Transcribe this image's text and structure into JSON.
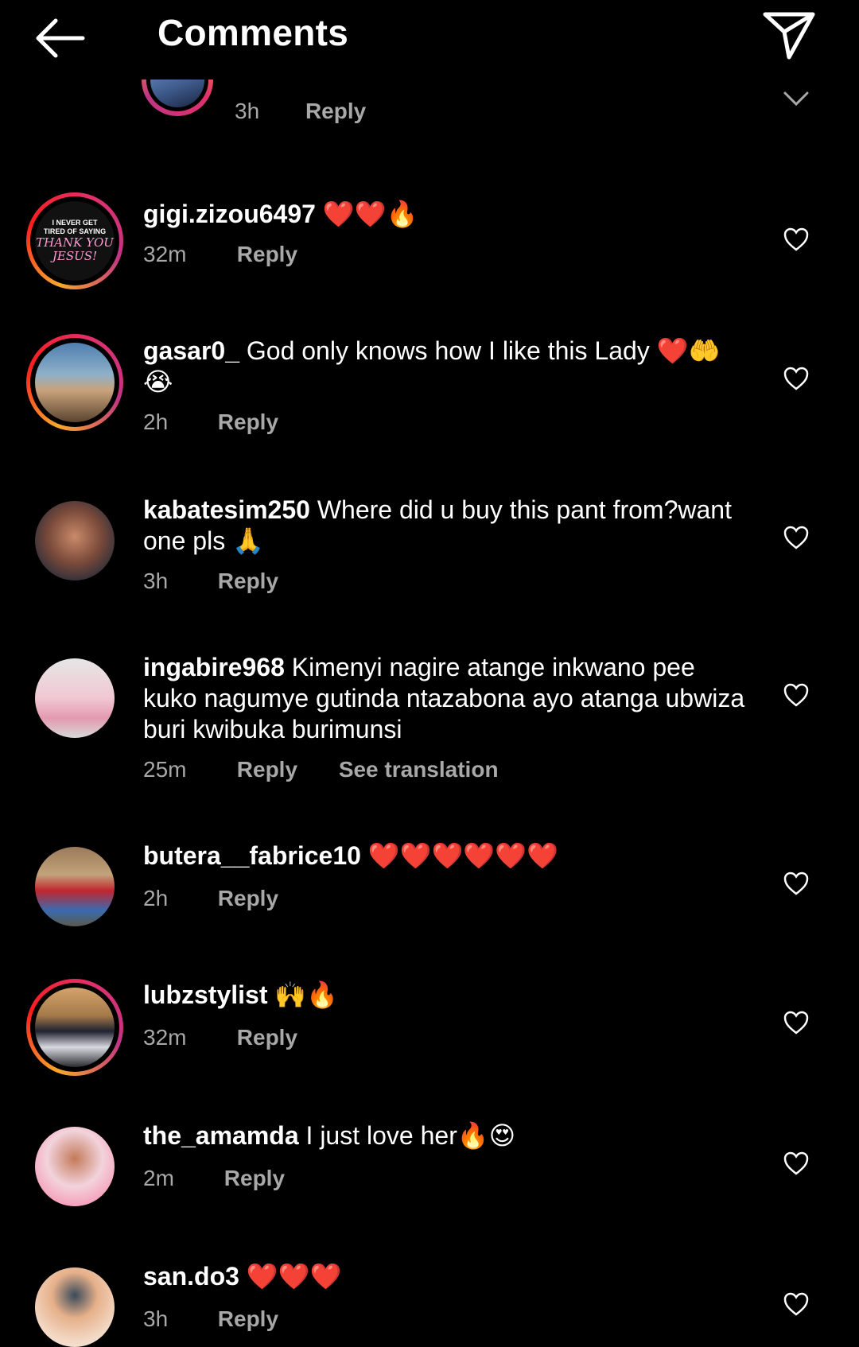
{
  "header": {
    "title": "Comments",
    "back_icon": "arrow-left-icon",
    "share_icon": "paper-plane-icon"
  },
  "partial_comment": {
    "time": "3h",
    "reply": "Reply"
  },
  "avatar_text": {
    "line1": "I NEVER GET",
    "line2": "TIRED OF SAYING",
    "line3": "THANK YOU",
    "line4": "JESUS!"
  },
  "comments": [
    {
      "username": "gigi.zizou6497",
      "text": "❤️❤️🔥",
      "time": "32m",
      "reply": "Reply"
    },
    {
      "username": "gasar0_",
      "text": "God only knows how I like this Lady ❤️🤲😭",
      "time": "2h",
      "reply": "Reply"
    },
    {
      "username": "kabatesim250",
      "text": "Where did u buy this pant from?want one pls 🙏",
      "time": "3h",
      "reply": "Reply"
    },
    {
      "username": "ingabire968",
      "text": "Kimenyi nagire atange inkwano pee kuko nagumye gutinda ntazabona ayo atanga ubwiza buri kwibuka  burimunsi",
      "time": "25m",
      "reply": "Reply",
      "translation": "See translation"
    },
    {
      "username": "butera__fabrice10",
      "text": "❤️❤️❤️❤️❤️❤️",
      "time": "2h",
      "reply": "Reply"
    },
    {
      "username": "lubzstylist",
      "text": "🙌🔥",
      "time": "32m",
      "reply": "Reply"
    },
    {
      "username": "the_amamda",
      "text": "I just love her🔥😍",
      "time": "2m",
      "reply": "Reply"
    },
    {
      "username": "san.do3",
      "text": "❤️❤️❤️",
      "time": "3h",
      "reply": "Reply"
    }
  ]
}
